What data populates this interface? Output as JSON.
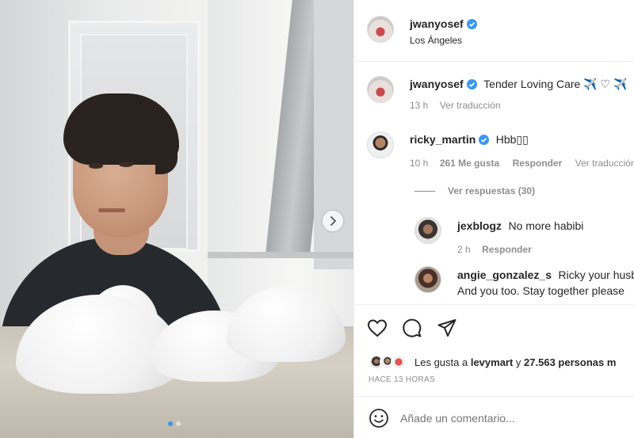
{
  "header": {
    "username": "jwanyosef",
    "location": "Los Ángeles"
  },
  "caption": {
    "username": "jwanyosef",
    "text": "Tender Loving Care ✈️ ♡ ✈️",
    "time": "13 h",
    "translate": "Ver traducción"
  },
  "comments": [
    {
      "username": "ricky_martin",
      "text": "Hbb▯▯",
      "time": "10 h",
      "likes": "261 Me gusta",
      "reply": "Responder",
      "translate": "Ver traducción",
      "view_replies": "Ver respuestas (30)"
    }
  ],
  "replies": [
    {
      "username": "jexblogz",
      "text": "No more habibi",
      "time": "2 h",
      "reply": "Responder"
    },
    {
      "username": "angie_gonzalez_s",
      "text": "Ricky your husb",
      "text2": "And you too. Stay together please"
    }
  ],
  "likes": {
    "prefix": "Les gusta a ",
    "user": "levymart",
    "middle": " y ",
    "count": "27.563 personas m"
  },
  "timestamp": "HACE 13 HORAS",
  "comment_input": {
    "placeholder": "Añade un comentario..."
  },
  "icons": {
    "verified": "verified-badge-icon",
    "like": "heart-icon",
    "comment": "comment-icon",
    "share": "send-icon",
    "emoji": "smile-icon",
    "next": "chevron-right-icon"
  },
  "colors": {
    "verified": "#3897f0",
    "muted": "#8e8e8e",
    "text": "#262626"
  }
}
